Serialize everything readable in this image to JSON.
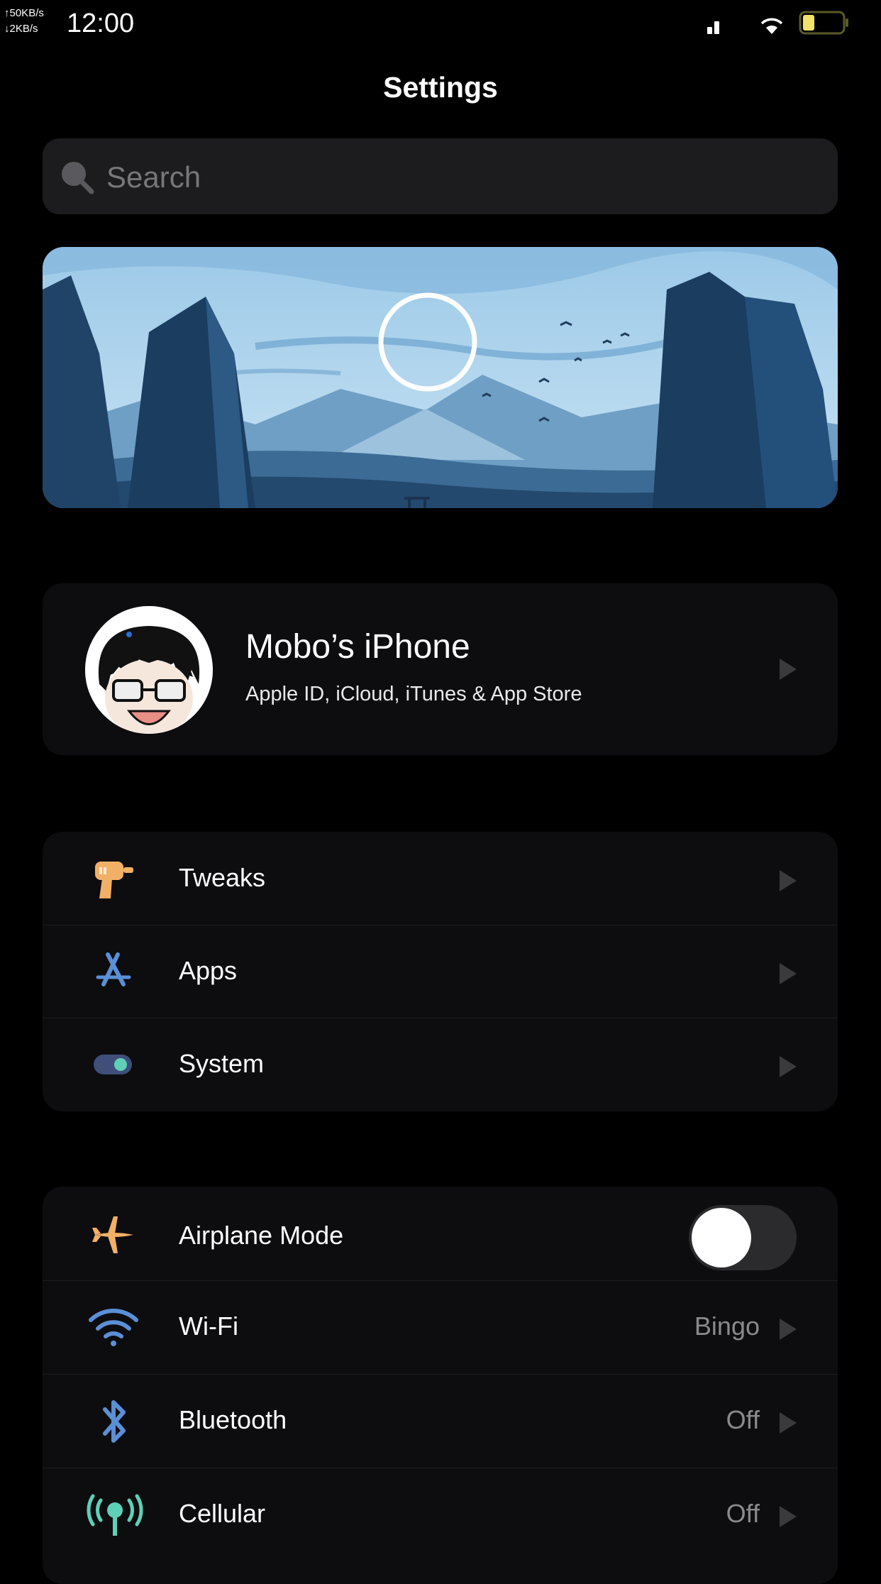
{
  "status_bar": {
    "upload_speed": "↑50KB/s",
    "download_speed": "↓2KB/s",
    "time": "12:00"
  },
  "title": "Settings",
  "search": {
    "placeholder": "Search"
  },
  "profile": {
    "name": "Mobo’s iPhone",
    "subtitle": "Apple ID, iCloud, iTunes & App Store"
  },
  "group1": [
    {
      "label": "Tweaks",
      "icon": "drill-icon"
    },
    {
      "label": "Apps",
      "icon": "app-store-icon"
    },
    {
      "label": "System",
      "icon": "toggle-switch-icon"
    }
  ],
  "group2": {
    "airplane": {
      "label": "Airplane Mode",
      "icon": "airplane-icon",
      "enabled": false
    },
    "wifi": {
      "label": "Wi-Fi",
      "value": "Bingo",
      "icon": "wifi-icon"
    },
    "bluetooth": {
      "label": "Bluetooth",
      "value": "Off",
      "icon": "bluetooth-icon"
    },
    "cellular": {
      "label": "Cellular",
      "value": "Off",
      "icon": "cellular-antenna-icon"
    }
  },
  "colors": {
    "background": "#000000",
    "card": "#0d0d0f",
    "search_bg": "#1c1c1e",
    "secondary_text": "#8a8a8e",
    "accent_orange": "#f2b066",
    "accent_blue": "#5b8fd6",
    "accent_teal": "#5fd0b8"
  }
}
